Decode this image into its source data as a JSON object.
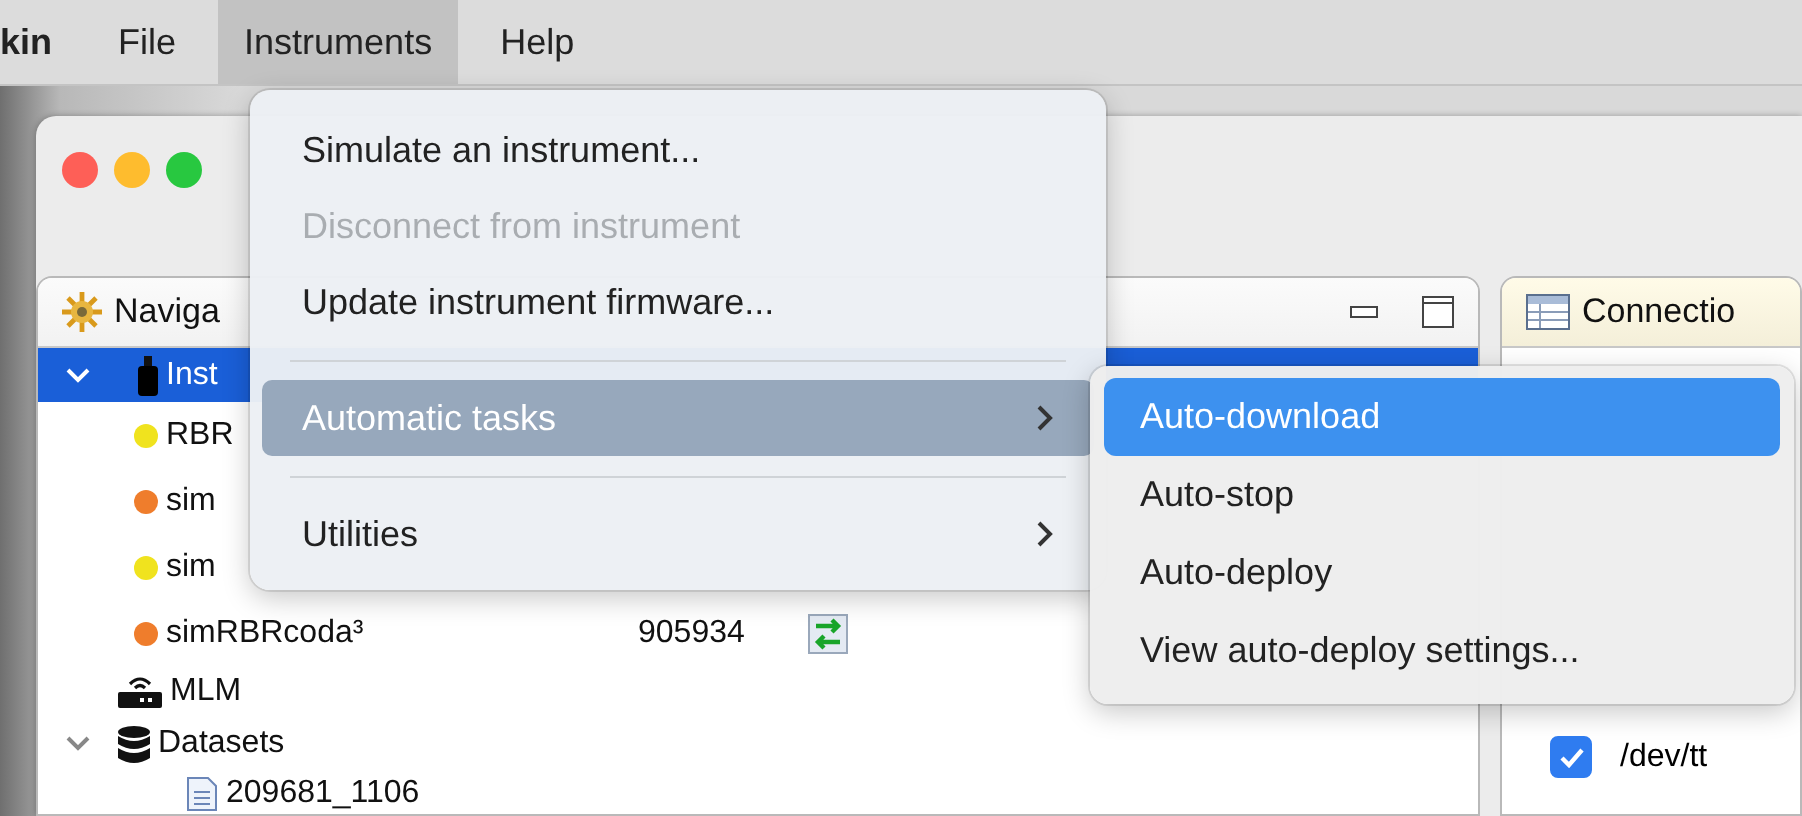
{
  "menubar": [
    {
      "label": "kin",
      "selected": false
    },
    {
      "label": "File",
      "selected": false
    },
    {
      "label": "Instruments",
      "selected": true
    },
    {
      "label": "Help",
      "selected": false
    }
  ],
  "menu": {
    "items": [
      {
        "kind": "item",
        "label": "Simulate an instrument...",
        "disabled": false,
        "selected": false,
        "submenu": false
      },
      {
        "kind": "item",
        "label": "Disconnect from instrument",
        "disabled": true,
        "selected": false,
        "submenu": false
      },
      {
        "kind": "item",
        "label": "Update instrument firmware...",
        "disabled": false,
        "selected": false,
        "submenu": false
      },
      {
        "kind": "separator"
      },
      {
        "kind": "item",
        "label": "Automatic tasks",
        "disabled": false,
        "selected": true,
        "submenu": true
      },
      {
        "kind": "separator"
      },
      {
        "kind": "item",
        "label": "Utilities",
        "disabled": false,
        "selected": false,
        "submenu": true
      }
    ]
  },
  "submenu": {
    "items": [
      {
        "label": "Auto-download",
        "selected": true
      },
      {
        "label": "Auto-stop",
        "selected": false
      },
      {
        "label": "Auto-deploy",
        "selected": false
      },
      {
        "label": "View auto-deploy settings...",
        "selected": false
      }
    ]
  },
  "navigator": {
    "title": "Naviga",
    "tree": [
      {
        "kind": "instruments",
        "label": "Inst",
        "expanded": true,
        "selected": true,
        "children": [
          {
            "kind": "instrument",
            "label": "RBR",
            "color": "#f0e31e",
            "selected": false
          },
          {
            "kind": "instrument",
            "label": "sim",
            "color": "#ef7d2c",
            "selected": false
          },
          {
            "kind": "instrument",
            "label": "sim",
            "color": "#f0e31e",
            "selected": false
          },
          {
            "kind": "instrument",
            "label": "simRBRcoda³",
            "color": "#ef7d2c",
            "serial": "905934",
            "syncing": true,
            "selected": false
          }
        ]
      },
      {
        "kind": "device",
        "label": "MLM",
        "selected": false
      },
      {
        "kind": "datasets",
        "label": "Datasets",
        "expanded": true,
        "selected": false,
        "children": [
          {
            "kind": "file",
            "label": "209681_1106",
            "selected": false
          }
        ]
      }
    ]
  },
  "connections": {
    "title": "Connectio",
    "rows": [
      {
        "label": "/dev/tt",
        "checked": true
      }
    ]
  }
}
